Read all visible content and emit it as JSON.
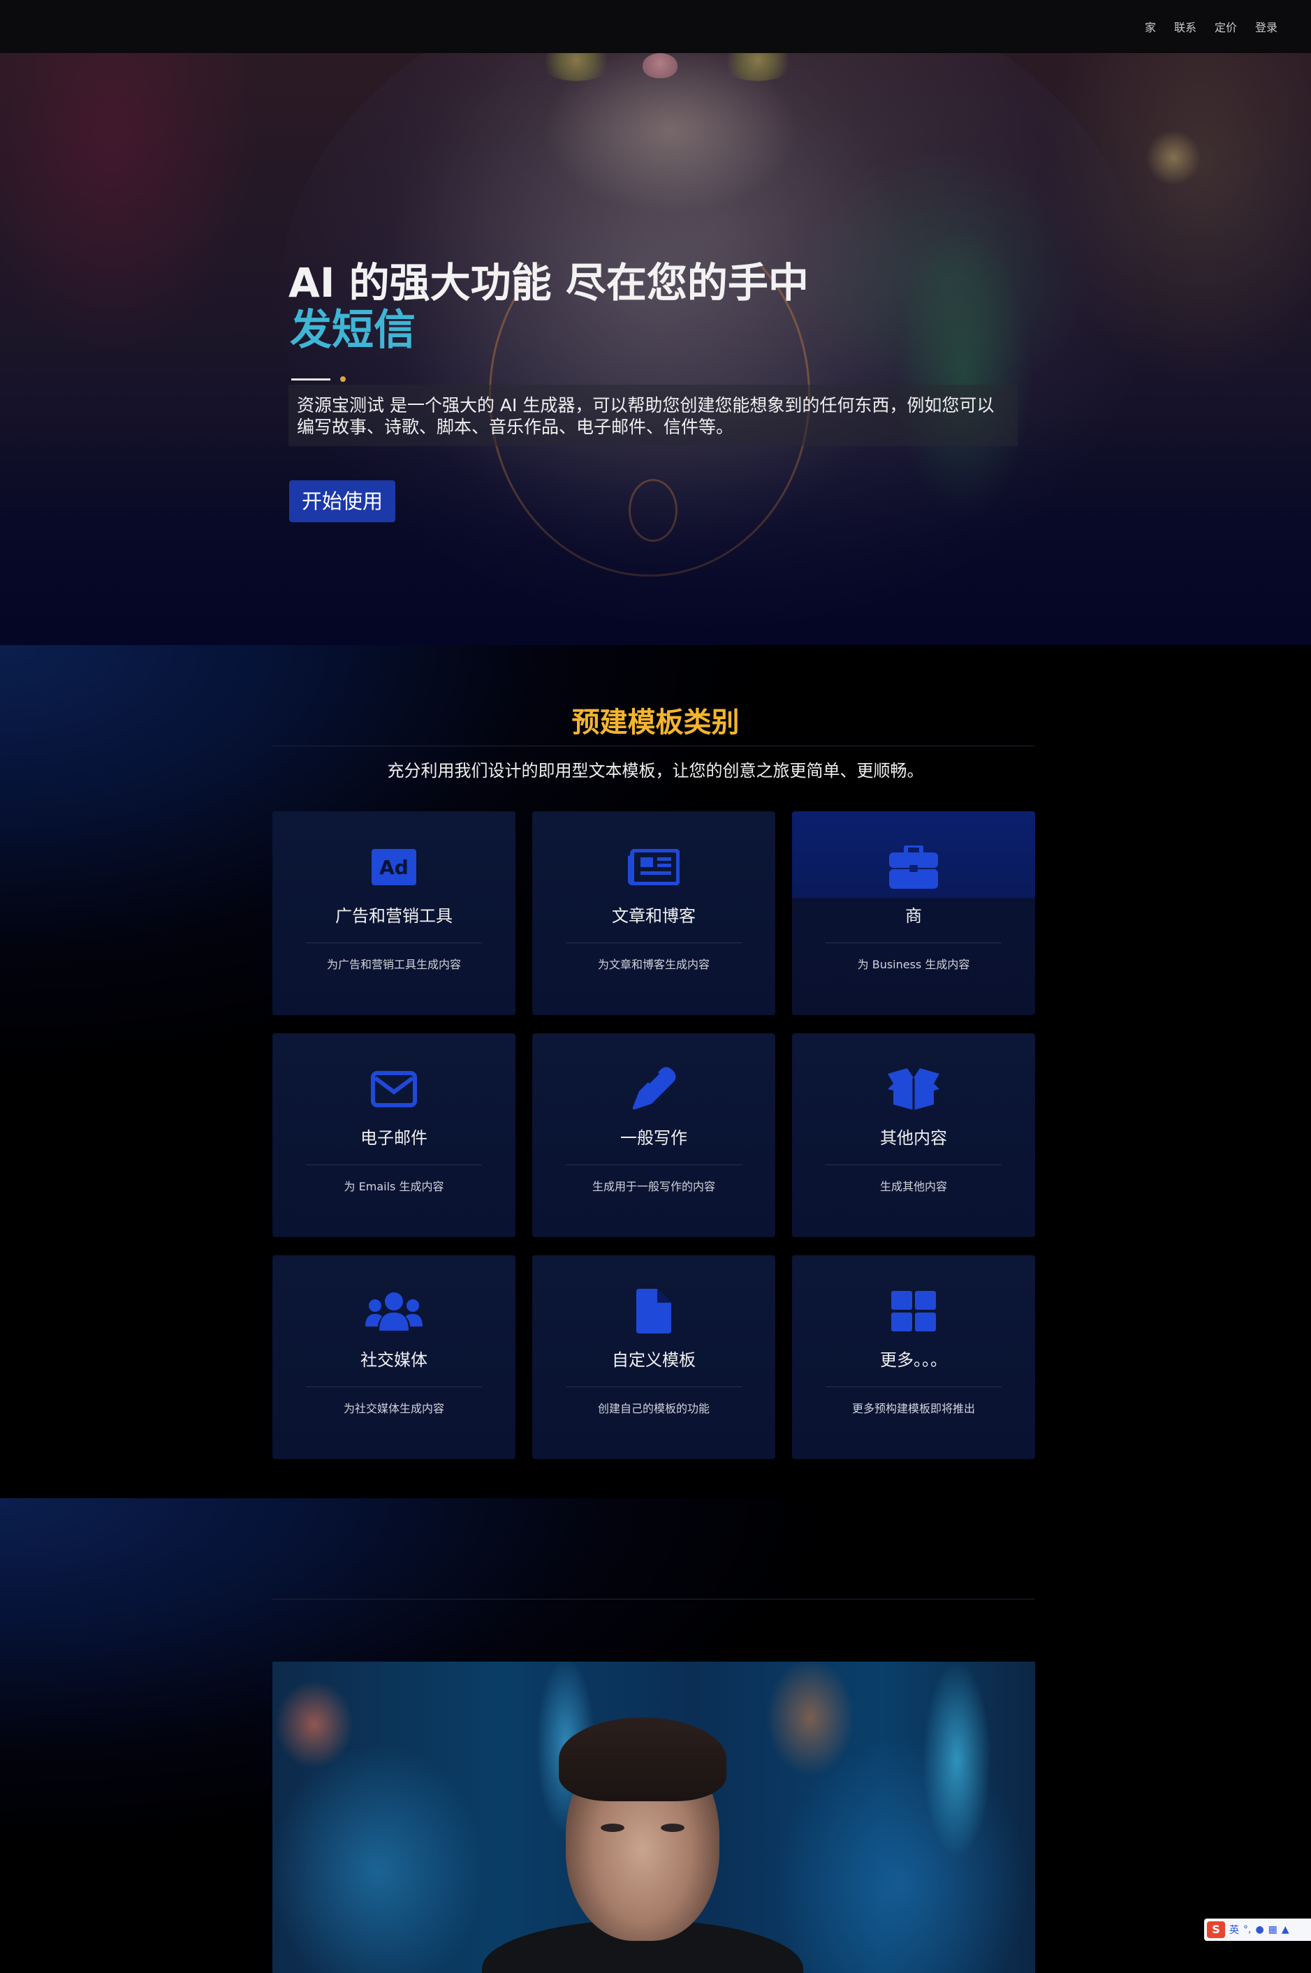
{
  "nav": {
    "links": [
      "家",
      "联系",
      "定价",
      "登录"
    ]
  },
  "hero": {
    "title_line1": "AI 的强大功能 尽在您的手中",
    "title_line2": "发短信",
    "description": "资源宝测试 是一个强大的 AI 生成器，可以帮助您创建您能想象到的任何东西，例如您可以编写故事、诗歌、脚本、音乐作品、电子邮件、信件等。",
    "cta_label": "开始使用"
  },
  "templates": {
    "title": "预建模板类别",
    "subtitle": "充分利用我们设计的即用型文本模板，让您的创意之旅更简单、更顺畅。",
    "cards": [
      {
        "icon": "ad-icon",
        "title": "广告和营销工具",
        "desc": "为广告和营销工具生成内容"
      },
      {
        "icon": "newspaper-icon",
        "title": "文章和博客",
        "desc": "为文章和博客生成内容"
      },
      {
        "icon": "briefcase-icon",
        "title": "商",
        "desc": "为 Business 生成内容"
      },
      {
        "icon": "envelope-icon",
        "title": "电子邮件",
        "desc": "为 Emails 生成内容"
      },
      {
        "icon": "pen-icon",
        "title": "一般写作",
        "desc": "生成用于一般写作的内容"
      },
      {
        "icon": "box-open-icon",
        "title": "其他内容",
        "desc": "生成其他内容"
      },
      {
        "icon": "users-icon",
        "title": "社交媒体",
        "desc": "为社交媒体生成内容"
      },
      {
        "icon": "file-icon",
        "title": "自定义模板",
        "desc": "创建自己的模板的功能"
      },
      {
        "icon": "grid-icon",
        "title": "更多。。。",
        "desc": "更多预构建模板即将推出"
      }
    ]
  },
  "ime": {
    "logo": "S",
    "mode": "英"
  },
  "colors": {
    "accent_blue": "#1b39a8",
    "title_gold": "#f4b52e",
    "hero_cyan": "#3fb6d6",
    "icon_blue": "#1f49d8"
  }
}
